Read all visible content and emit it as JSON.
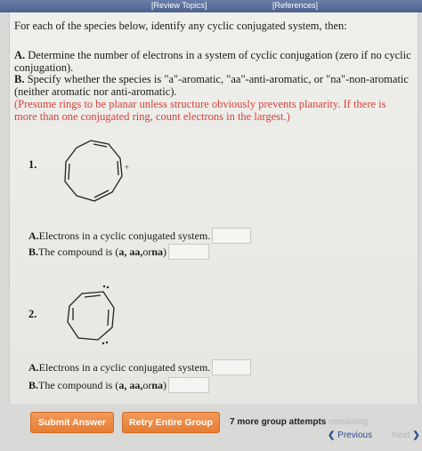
{
  "header": {
    "review_topics": "[Review Topics]",
    "references": "[References]"
  },
  "intro": {
    "text": "For each of the species below, identify any cyclic conjugated system, then:"
  },
  "steps": {
    "a_letter": "A.",
    "a_text": " Determine the number of electrons in a system of cyclic conjugation (zero if no cyclic conjugation).",
    "b_letter": "B.",
    "b_text": " Specify whether the species is \"a\"-aromatic, \"aa\"-anti-aromatic, or \"na\"-non-aromatic (neither aromatic nor anti-aromatic).",
    "note": "(Presume rings to be planar unless structure obviously prevents planarity. If there is more than one conjugated ring, count electrons in the largest.)"
  },
  "questions": [
    {
      "number": "1.",
      "charge": "+",
      "a_letter": "A.",
      "a_label": "Electrons in a cyclic conjugated system.",
      "a_value": "",
      "b_letter": "B.",
      "b_label_pre": "The compound is (",
      "b_label_bold": "a, aa,",
      "b_label_mid": " or ",
      "b_label_bold2": "na",
      "b_label_post": ")",
      "b_value": ""
    },
    {
      "number": "2.",
      "a_letter": "A.",
      "a_label": "Electrons in a cyclic conjugated system.",
      "a_value": "",
      "b_letter": "B.",
      "b_label_pre": "The compound is (",
      "b_label_bold": "a, aa,",
      "b_label_mid": " or ",
      "b_label_bold2": "na",
      "b_label_post": ")",
      "b_value": ""
    }
  ],
  "footer": {
    "submit_label": "Submit Answer",
    "retry_label": "Retry Entire Group",
    "attempts_text": "7 more group attempts ",
    "attempts_fade": "remaining",
    "previous_label": "Previous",
    "next_label": "Next"
  },
  "colors": {
    "accent_orange": "#e57d34",
    "note_red": "#d9413a",
    "nav_blue": "#2a4f8f"
  }
}
